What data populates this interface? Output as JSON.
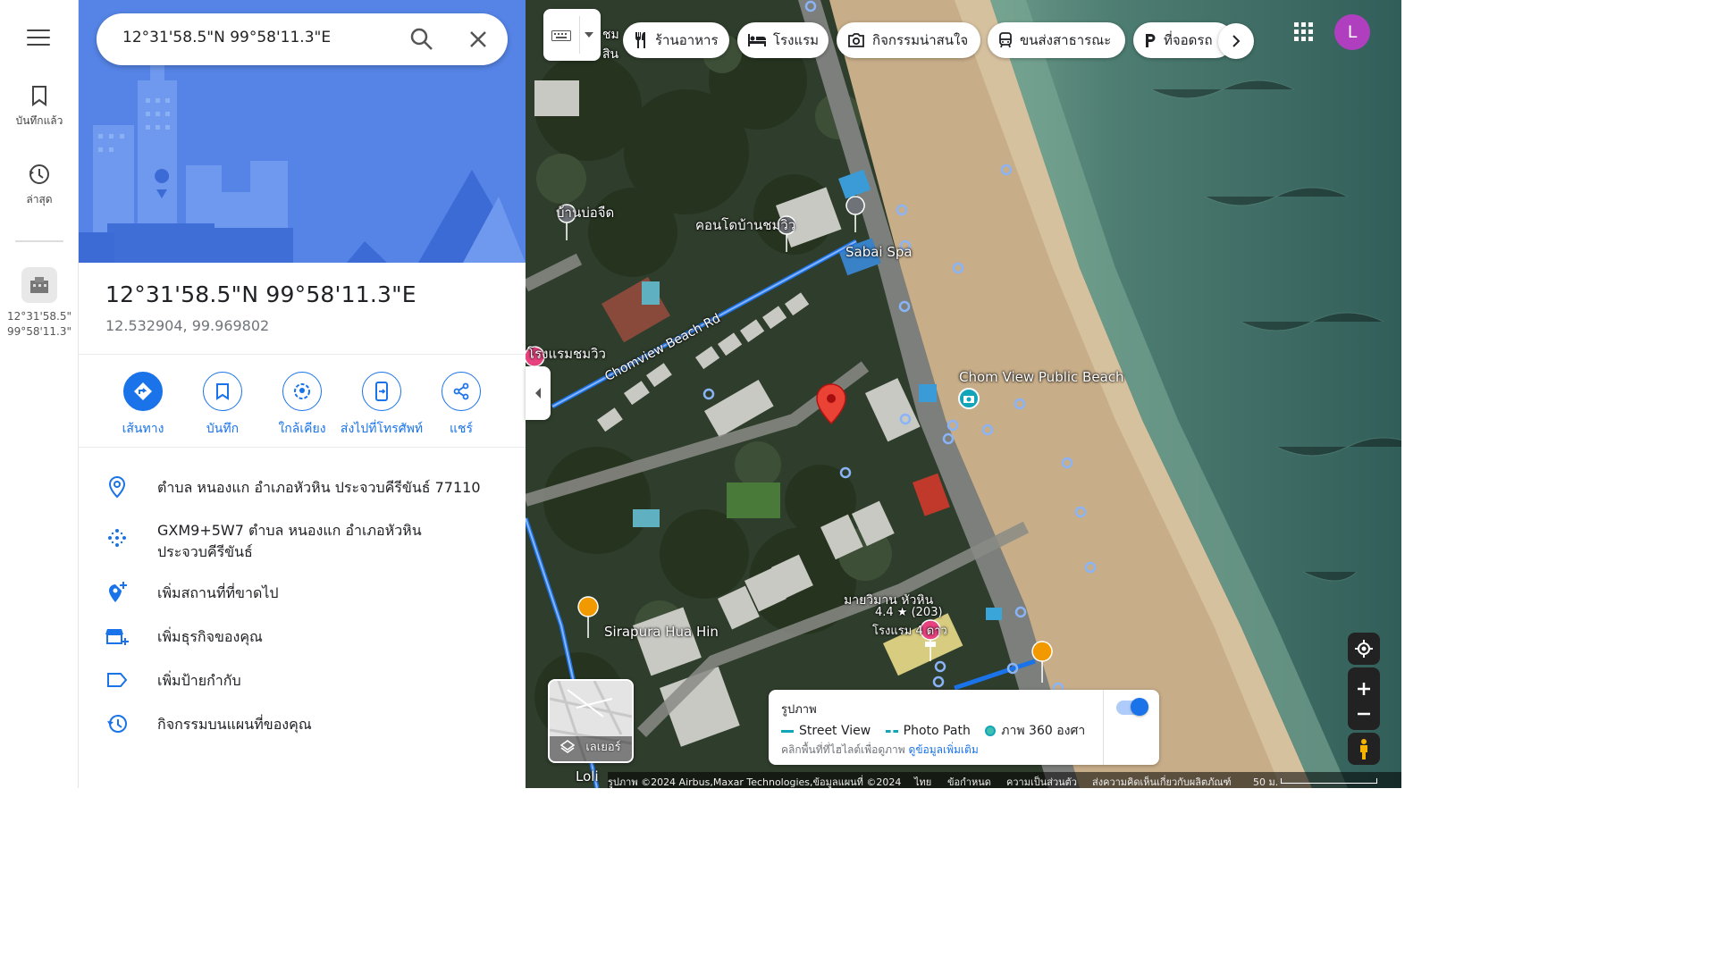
{
  "rail": {
    "saved_label": "บันทึกแล้ว",
    "recent_label": "ล่าสุด",
    "recent_item_line1": "12°31'58.5\"",
    "recent_item_line2": "99°58'11.3\""
  },
  "search": {
    "value": "12°31'58.5\"N 99°58'11.3\"E"
  },
  "place": {
    "title": "12°31'58.5\"N 99°58'11.3\"E",
    "coords": "12.532904, 99.969802"
  },
  "actions": [
    {
      "label": "เส้นทาง",
      "icon": "directions-icon"
    },
    {
      "label": "บันทึก",
      "icon": "bookmark-icon"
    },
    {
      "label": "ใกล้เคียง",
      "icon": "nearby-icon"
    },
    {
      "label": "ส่งไปที่โทรศัพท์",
      "icon": "send-to-phone-icon"
    },
    {
      "label": "แชร์",
      "icon": "share-icon"
    }
  ],
  "info": {
    "address": "ตำบล หนองแก อำเภอหัวหิน ประจวบคีรีขันธ์ 77110",
    "plus_code_line1": "GXM9+5W7 ตำบล หนองแก อำเภอหัวหิน",
    "plus_code_line2": "ประจวบคีรีขันธ์",
    "add_missing": "เพิ่มสถานที่ที่ขาดไป",
    "add_business": "เพิ่มธุรกิจของคุณ",
    "add_label": "เพิ่มป้ายกำกับ",
    "map_activity": "กิจกรรมบนแผนที่ของคุณ"
  },
  "chips": {
    "restaurants": "ร้านอาหาร",
    "hotels": "โรงแรม",
    "things_to_do": "กิจกรรมน่าสนใจ",
    "transit": "ขนส่งสาธารณะ",
    "parking": "ที่จอดรถ"
  },
  "user": {
    "initial": "L"
  },
  "map_labels": {
    "baan_bo_chuet": "บ้านบ่อจืด",
    "condo": "คอนโดบ้านชมวิว",
    "sabai_spa": "Sabai Spa",
    "hotel_chomview": "โรงแรมชมวิว",
    "road": "Chomview Beach Rd",
    "public_beach": "Chom View Public Beach",
    "sirapura": "Sirapura Hua Hin",
    "maiwiman": "มายวิมาน หัวหิน",
    "maiwiman_rating": "4.4 ★ (203)",
    "maiwiman_type": "โรงแรม 4 ดาว",
    "top_partial": "ชม",
    "top_partial2": "สิน",
    "bottom_partial": "Loli"
  },
  "layers": {
    "label": "เลเยอร์"
  },
  "legend": {
    "title": "รูปภาพ",
    "street_view": "Street View",
    "photo_path": "Photo Path",
    "photo_360": "ภาพ 360 องศา",
    "note": "คลิกพื้นที่ที่ไฮไลต์เพื่อดูภาพ",
    "more_link": "ดูข้อมูลเพิ่มเติม",
    "toggle_on": true
  },
  "footer": {
    "imagery": "รูปภาพ ©2024 Airbus,Maxar Technologies,ข้อมูลแผนที่ ©2024",
    "language": "ไทย",
    "terms": "ข้อกำหนด",
    "privacy": "ความเป็นส่วนตัว",
    "feedback": "ส่งความคิดเห็นเกี่ยวกับผลิตภัณฑ์",
    "scale": "50 ม."
  },
  "colors": {
    "accent": "#1a73e8",
    "pin": "#ea4335",
    "avatar": "#b03fbf",
    "sea": "#4f7f70",
    "sand": "#c9b08d"
  }
}
